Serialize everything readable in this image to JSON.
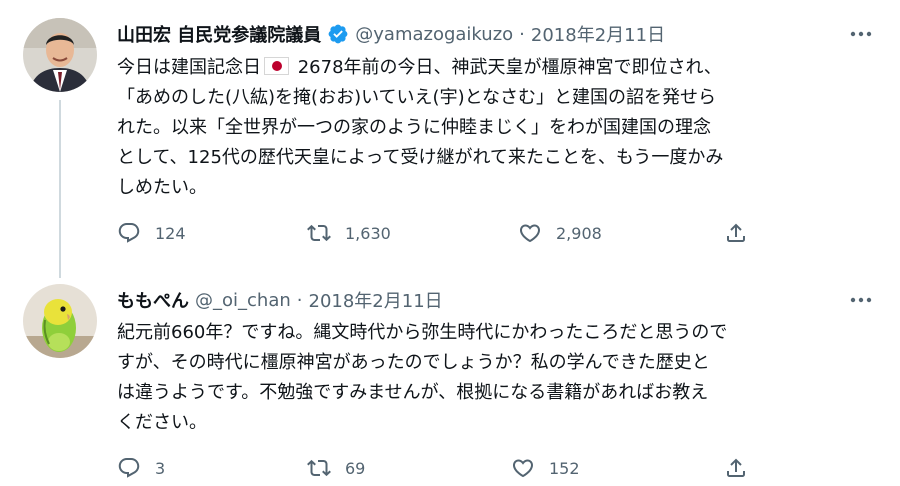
{
  "tweets": [
    {
      "name": "山田宏 自民党参議院議員",
      "verified": true,
      "handle": "@yamazogaikuzo",
      "separator": "·",
      "date": "2018年2月11日",
      "text_before_flag": "今日は建国記念日",
      "text_after_flag": " 2678年前の今日、神武天皇が橿原神宮で即位され、\n「あめのした(八紘)を掩(おお)いていえ(宇)となさむ」と建国の詔を発せら\nれた。以来「全世界が一つの家のように仲睦まじく」をわが国建国の理念\nとして、125代の歴代天皇によって受け継がれて来たことを、もう一度かみ\nしめたい。",
      "flag_icon": "japan-flag-emoji",
      "replies": "124",
      "retweets": "1,630",
      "likes": "2,908"
    },
    {
      "name": "ももぺん",
      "verified": false,
      "handle": "@_oi_chan",
      "separator": "·",
      "date": "2018年2月11日",
      "text": "紀元前660年？ですね。縄文時代から弥生時代にかわったころだと思うので\nすが、その時代に橿原神宮があったのでしょうか？私の学んできた歴史と\nは違うようです。不勉強ですみませんが、根拠になる書籍があればお教え\nください。",
      "replies": "3",
      "retweets": "69",
      "likes": "152"
    }
  ],
  "colors": {
    "text": "#0f1419",
    "secondary": "#536471",
    "verified": "#1d9bf0",
    "thread_line": "#cfd9de"
  },
  "icons": [
    "reply-icon",
    "retweet-icon",
    "like-icon",
    "share-icon",
    "more-icon",
    "verified-badge-icon"
  ]
}
